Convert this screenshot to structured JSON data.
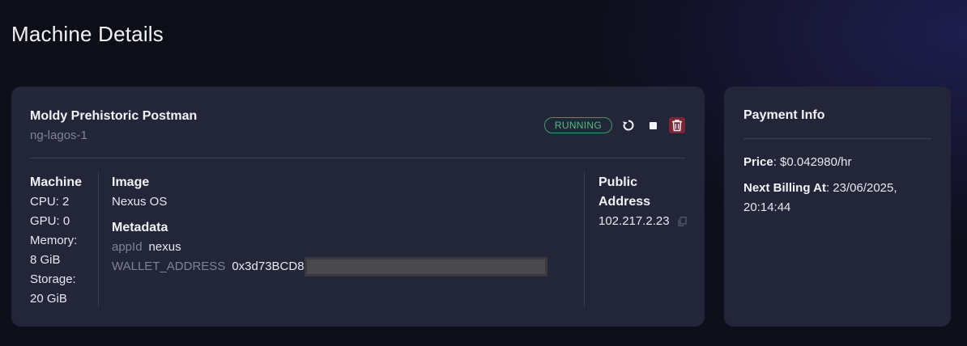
{
  "page": {
    "title": "Machine Details"
  },
  "machine": {
    "name": "Moldy Prehistoric Postman",
    "region": "ng-lagos-1",
    "status": "RUNNING",
    "icons": {
      "restart": "restart-icon",
      "stop": "stop-icon",
      "delete": "trash-icon"
    },
    "specs": {
      "heading": "Machine",
      "cpu": "CPU: 2",
      "gpu": "GPU: 0",
      "memory_label": "Memory:",
      "memory_value": "8 GiB",
      "storage_label": "Storage:",
      "storage_value": "20 GiB"
    },
    "image": {
      "heading": "Image",
      "value": "Nexus OS"
    },
    "metadata": {
      "heading": "Metadata",
      "rows": [
        {
          "key": "appId",
          "value": "nexus"
        },
        {
          "key": "WALLET_ADDRESS",
          "value": "0x3d73BCD8"
        }
      ]
    },
    "public_address": {
      "heading_line1": "Public",
      "heading_line2": "Address",
      "value": "102.217.2.23"
    }
  },
  "payment": {
    "title": "Payment Info",
    "price_label": "Price",
    "price_value": ": $0.042980/hr",
    "billing_label": "Next Billing At",
    "billing_value": ": 23/06/2025, 20:14:44"
  },
  "colors": {
    "background": "#0d0e18",
    "card": "#232539",
    "status_green": "#4bc07a",
    "delete_red": "#7b2636",
    "muted": "#7f8299"
  }
}
